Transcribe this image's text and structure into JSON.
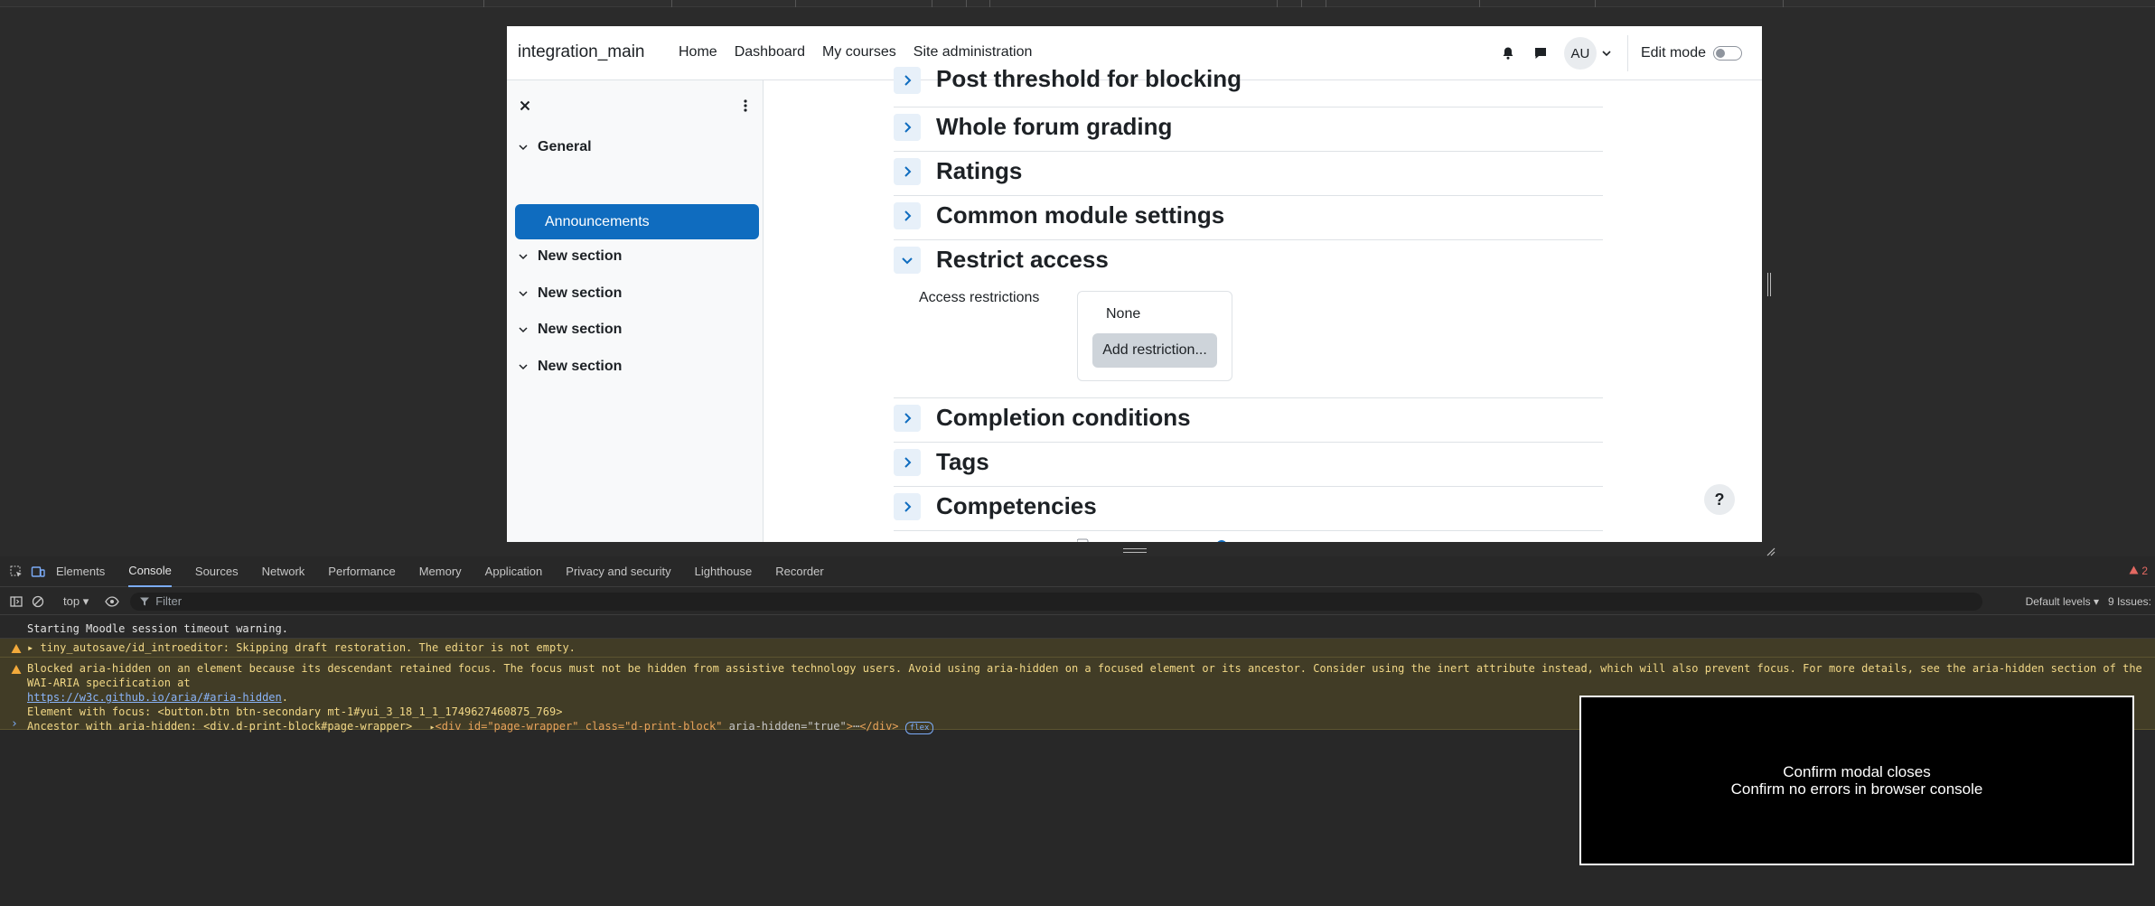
{
  "navbar": {
    "brand": "integration_main",
    "links": [
      "Home",
      "Dashboard",
      "My courses",
      "Site administration"
    ],
    "avatar_initials": "AU",
    "edit_mode_label": "Edit mode"
  },
  "drawer": {
    "items": [
      {
        "label": "General"
      },
      {
        "label": "Announcements"
      },
      {
        "label": "New section"
      },
      {
        "label": "New section"
      },
      {
        "label": "New section"
      },
      {
        "label": "New section"
      }
    ]
  },
  "sections": [
    {
      "title": "Post threshold for blocking",
      "expanded": false
    },
    {
      "title": "Whole forum grading",
      "expanded": false
    },
    {
      "title": "Ratings",
      "expanded": false
    },
    {
      "title": "Common module settings",
      "expanded": false
    },
    {
      "title": "Restrict access",
      "expanded": true
    },
    {
      "title": "Completion conditions",
      "expanded": false
    },
    {
      "title": "Tags",
      "expanded": false
    },
    {
      "title": "Competencies",
      "expanded": false
    }
  ],
  "restrict_access": {
    "label": "Access restrictions",
    "none_text": "None",
    "add_button": "Add restriction..."
  },
  "help_glyph": "?",
  "devtools": {
    "tabs": [
      "Elements",
      "Console",
      "Sources",
      "Network",
      "Performance",
      "Memory",
      "Application",
      "Privacy and security",
      "Lighthouse",
      "Recorder"
    ],
    "active_tab": "Console",
    "issues_badge": "2",
    "context": "top",
    "filter_placeholder": "Filter",
    "levels": "Default levels",
    "issues_count": "9 Issues:",
    "log_info": "Starting Moodle session timeout warning.",
    "log_warn1": "tiny_autosave/id_introeditor: Skipping draft restoration. The editor is not empty.",
    "log_warn2_line1": "Blocked aria-hidden on an element because its descendant retained focus. The focus must not be hidden from assistive technology users. Avoid using aria-hidden on a focused element or its ancestor. Consider using the inert attribute instead, which will also prevent focus. For more details, see the aria-hidden section of the WAI-ARIA specification at",
    "log_warn2_link": "https://w3c.github.io/aria/#aria-hidden",
    "log_warn2_line3": "Element with focus: <button.btn btn-secondary mt-1#yui_3_18_1_1_1749627460875_769>",
    "log_warn2_line4_prefix": "Ancestor with aria-hidden: <div.d-print-block#page-wrapper>",
    "log_warn2_tag_open": "<div ",
    "log_warn2_attr1": "id=\"page-wrapper\"",
    "log_warn2_attr2": "class=\"d-print-block\"",
    "log_warn2_attr3": "aria-hidden=\"true\"",
    "log_warn2_ellipsis": "⋯",
    "log_warn2_tag_close": "</div>",
    "log_warn2_badge": "flex",
    "prompt_glyph": "›"
  },
  "overlay": {
    "line1": "Confirm modal closes",
    "line2": "Confirm no errors in browser console"
  }
}
